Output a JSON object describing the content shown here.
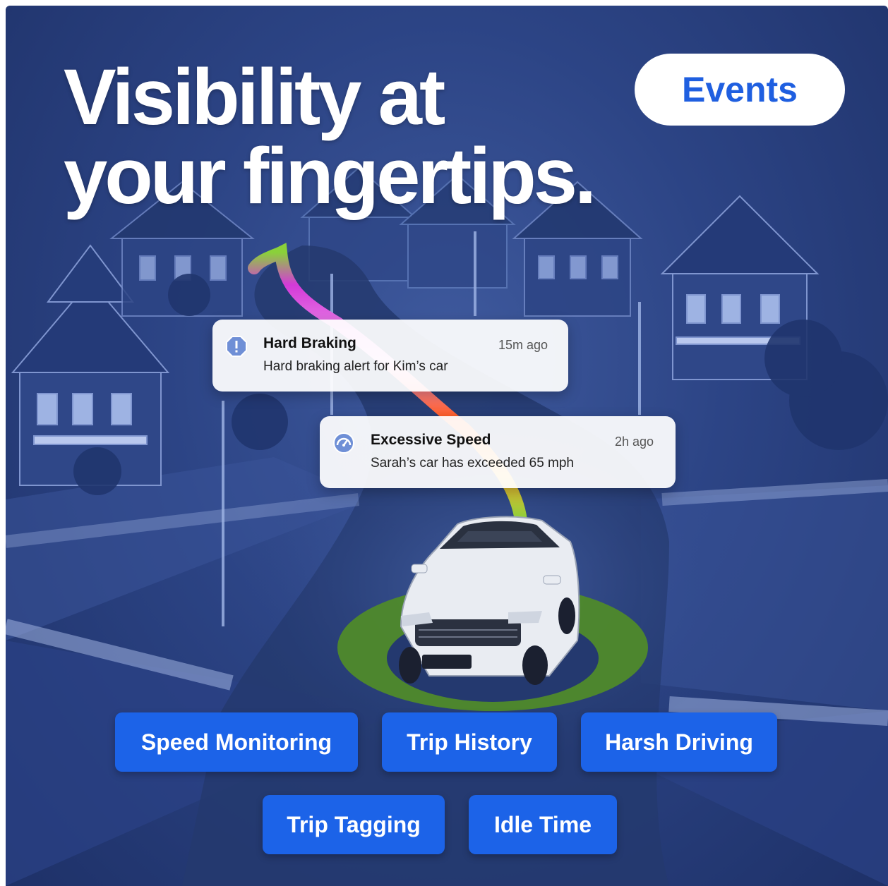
{
  "headline": {
    "line1": "Visibility at",
    "line2": "your fingertips."
  },
  "events_button": {
    "label": "Events"
  },
  "notifications": [
    {
      "icon": "alert-octagon-icon",
      "title": "Hard Braking",
      "time": "15m ago",
      "body": "Hard braking alert for Kim’s car"
    },
    {
      "icon": "speedometer-icon",
      "title": "Excessive Speed",
      "time": "2h ago",
      "body": "Sarah’s car has exceeded 65 mph"
    }
  ],
  "feature_chips": [
    {
      "label": "Speed Monitoring"
    },
    {
      "label": "Trip History"
    },
    {
      "label": "Harsh Driving"
    },
    {
      "label": "Trip Tagging"
    },
    {
      "label": "Idle Time"
    }
  ],
  "colors": {
    "accent": "#1c63e8",
    "events_text": "#1f5fe0",
    "background": "#2c4485",
    "route_start": "#8ad13a",
    "route_mid": "#d43ad8",
    "route_hot": "#ff5a1f",
    "car_ring": "#4f8a2a"
  }
}
